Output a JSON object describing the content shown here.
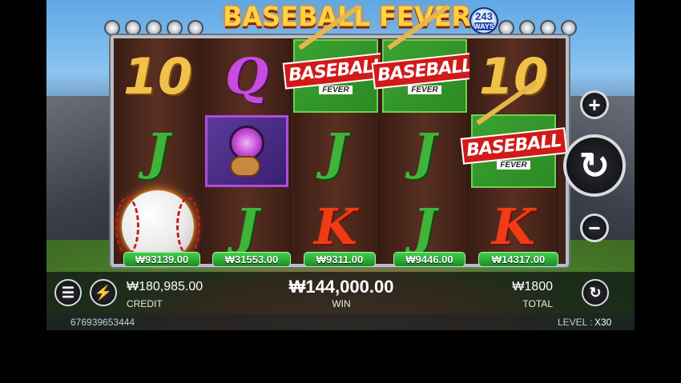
{
  "game": {
    "title": "BASEBALL FEVER",
    "ways_num": "243",
    "ways_label": "WAYS"
  },
  "reels": [
    [
      "10",
      "J",
      "baseball"
    ],
    [
      "Q",
      "catcher",
      "J"
    ],
    [
      "baseball-fever",
      "J",
      "K"
    ],
    [
      "baseball-fever",
      "J",
      "J"
    ],
    [
      "10",
      "baseball-fever",
      "K"
    ]
  ],
  "symbol_text": {
    "logo_line1": "BASEBALL",
    "logo_line2": "FEVER"
  },
  "reel_wins": [
    "₩93139.00",
    "₩31553.00",
    "₩9311.00",
    "₩9446.00",
    "₩14317.00"
  ],
  "controls": {
    "plus": "+",
    "minus": "−",
    "menu_icon": "hamburger-menu-icon",
    "turbo_icon": "lightning-icon",
    "spin_icon": "refresh-icon",
    "autoplay_icon": "autoplay-icon"
  },
  "stats": {
    "credit_value": "₩180,985.00",
    "credit_label": "CREDIT",
    "win_value": "₩144,000.00",
    "win_label": "WIN",
    "total_value": "₩1800",
    "total_label": "TOTAL"
  },
  "footer": {
    "session_id": "676939653444",
    "level_label": "LEVEL :",
    "level_value": "X30"
  },
  "colors": {
    "win_green": "#2fb03a",
    "title_gold": "#ffd23f",
    "logo_red": "#d11a1a"
  }
}
